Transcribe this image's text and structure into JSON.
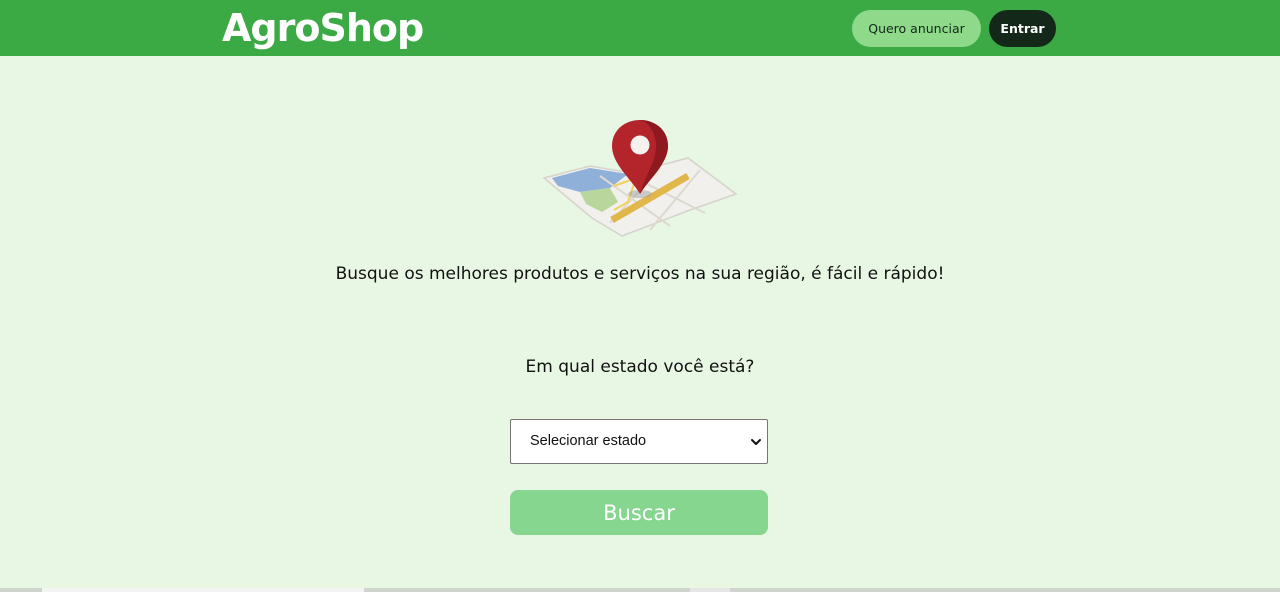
{
  "header": {
    "brand": "AgroShop",
    "advertise_label": "Quero anunciar",
    "login_label": "Entrar"
  },
  "hero": {
    "illustration_icon": "map-pin-icon",
    "headline": "Busque os melhores produtos e serviços na sua região, é fácil e rápido!"
  },
  "search": {
    "question": "Em qual estado você está?",
    "state_select_value": "Selecionar estado",
    "submit_label": "Buscar"
  },
  "colors": {
    "header_bg": "#3ba944",
    "page_bg": "#e8f6e4",
    "advertise_bg": "#8ed98a",
    "login_bg": "#14281a",
    "submit_bg": "#86d690"
  }
}
